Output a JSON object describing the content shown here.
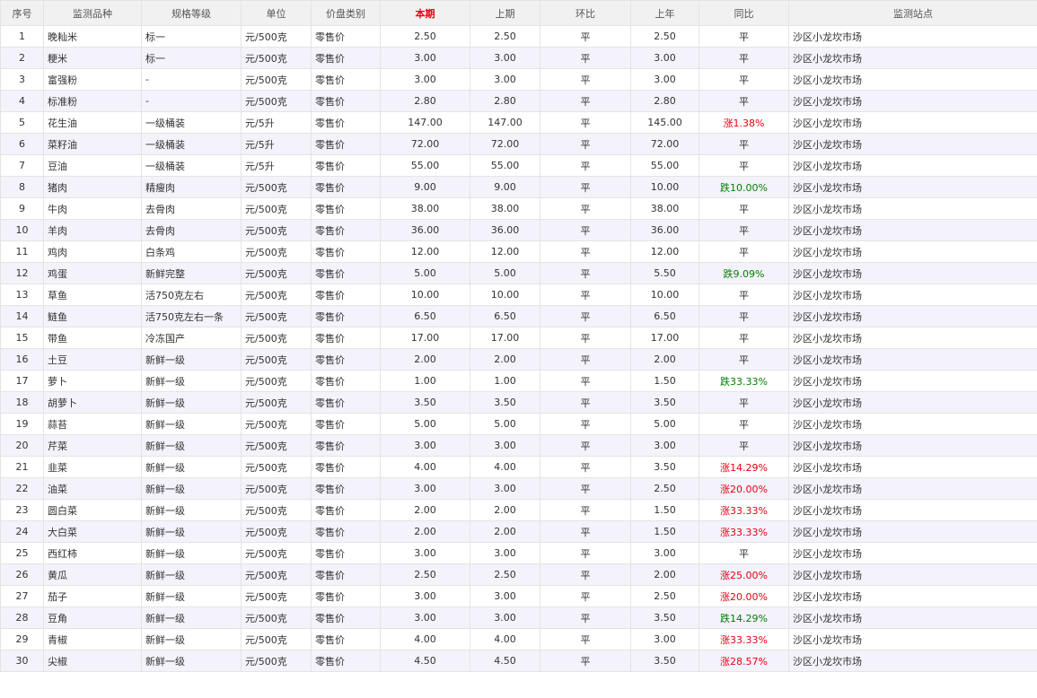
{
  "columns": [
    "序号",
    "监测品种",
    "规格等级",
    "单位",
    "价盘类别",
    "本期",
    "上期",
    "环比",
    "上年",
    "同比",
    "监测站点"
  ],
  "rows": [
    {
      "no": "1",
      "name": "晚籼米",
      "spec": "标一",
      "unit": "元/500克",
      "category": "零售价",
      "current": "2.50",
      "previous": "2.50",
      "mom": "平",
      "last_year": "2.50",
      "yoy": "平",
      "yoy_trend": "flat",
      "station": "沙区小龙坎市场"
    },
    {
      "no": "2",
      "name": "粳米",
      "spec": "标一",
      "unit": "元/500克",
      "category": "零售价",
      "current": "3.00",
      "previous": "3.00",
      "mom": "平",
      "last_year": "3.00",
      "yoy": "平",
      "yoy_trend": "flat",
      "station": "沙区小龙坎市场"
    },
    {
      "no": "3",
      "name": "富强粉",
      "spec": "-",
      "unit": "元/500克",
      "category": "零售价",
      "current": "3.00",
      "previous": "3.00",
      "mom": "平",
      "last_year": "3.00",
      "yoy": "平",
      "yoy_trend": "flat",
      "station": "沙区小龙坎市场"
    },
    {
      "no": "4",
      "name": "标准粉",
      "spec": "-",
      "unit": "元/500克",
      "category": "零售价",
      "current": "2.80",
      "previous": "2.80",
      "mom": "平",
      "last_year": "2.80",
      "yoy": "平",
      "yoy_trend": "flat",
      "station": "沙区小龙坎市场"
    },
    {
      "no": "5",
      "name": "花生油",
      "spec": "一级桶装",
      "unit": "元/5升",
      "category": "零售价",
      "current": "147.00",
      "previous": "147.00",
      "mom": "平",
      "last_year": "145.00",
      "yoy": "涨1.38%",
      "yoy_trend": "up",
      "station": "沙区小龙坎市场"
    },
    {
      "no": "6",
      "name": "菜籽油",
      "spec": "一级桶装",
      "unit": "元/5升",
      "category": "零售价",
      "current": "72.00",
      "previous": "72.00",
      "mom": "平",
      "last_year": "72.00",
      "yoy": "平",
      "yoy_trend": "flat",
      "station": "沙区小龙坎市场"
    },
    {
      "no": "7",
      "name": "豆油",
      "spec": "一级桶装",
      "unit": "元/5升",
      "category": "零售价",
      "current": "55.00",
      "previous": "55.00",
      "mom": "平",
      "last_year": "55.00",
      "yoy": "平",
      "yoy_trend": "flat",
      "station": "沙区小龙坎市场"
    },
    {
      "no": "8",
      "name": "猪肉",
      "spec": "精瘦肉",
      "unit": "元/500克",
      "category": "零售价",
      "current": "9.00",
      "previous": "9.00",
      "mom": "平",
      "last_year": "10.00",
      "yoy": "跌10.00%",
      "yoy_trend": "down",
      "station": "沙区小龙坎市场"
    },
    {
      "no": "9",
      "name": "牛肉",
      "spec": "去骨肉",
      "unit": "元/500克",
      "category": "零售价",
      "current": "38.00",
      "previous": "38.00",
      "mom": "平",
      "last_year": "38.00",
      "yoy": "平",
      "yoy_trend": "flat",
      "station": "沙区小龙坎市场"
    },
    {
      "no": "10",
      "name": "羊肉",
      "spec": "去骨肉",
      "unit": "元/500克",
      "category": "零售价",
      "current": "36.00",
      "previous": "36.00",
      "mom": "平",
      "last_year": "36.00",
      "yoy": "平",
      "yoy_trend": "flat",
      "station": "沙区小龙坎市场"
    },
    {
      "no": "11",
      "name": "鸡肉",
      "spec": "白条鸡",
      "unit": "元/500克",
      "category": "零售价",
      "current": "12.00",
      "previous": "12.00",
      "mom": "平",
      "last_year": "12.00",
      "yoy": "平",
      "yoy_trend": "flat",
      "station": "沙区小龙坎市场"
    },
    {
      "no": "12",
      "name": "鸡蛋",
      "spec": "新鲜完整",
      "unit": "元/500克",
      "category": "零售价",
      "current": "5.00",
      "previous": "5.00",
      "mom": "平",
      "last_year": "5.50",
      "yoy": "跌9.09%",
      "yoy_trend": "down",
      "station": "沙区小龙坎市场"
    },
    {
      "no": "13",
      "name": "草鱼",
      "spec": "活750克左右",
      "unit": "元/500克",
      "category": "零售价",
      "current": "10.00",
      "previous": "10.00",
      "mom": "平",
      "last_year": "10.00",
      "yoy": "平",
      "yoy_trend": "flat",
      "station": "沙区小龙坎市场"
    },
    {
      "no": "14",
      "name": "鲢鱼",
      "spec": "活750克左右一条",
      "unit": "元/500克",
      "category": "零售价",
      "current": "6.50",
      "previous": "6.50",
      "mom": "平",
      "last_year": "6.50",
      "yoy": "平",
      "yoy_trend": "flat",
      "station": "沙区小龙坎市场"
    },
    {
      "no": "15",
      "name": "带鱼",
      "spec": "冷冻国产",
      "unit": "元/500克",
      "category": "零售价",
      "current": "17.00",
      "previous": "17.00",
      "mom": "平",
      "last_year": "17.00",
      "yoy": "平",
      "yoy_trend": "flat",
      "station": "沙区小龙坎市场"
    },
    {
      "no": "16",
      "name": "土豆",
      "spec": "新鲜一级",
      "unit": "元/500克",
      "category": "零售价",
      "current": "2.00",
      "previous": "2.00",
      "mom": "平",
      "last_year": "2.00",
      "yoy": "平",
      "yoy_trend": "flat",
      "station": "沙区小龙坎市场"
    },
    {
      "no": "17",
      "name": "萝卜",
      "spec": "新鲜一级",
      "unit": "元/500克",
      "category": "零售价",
      "current": "1.00",
      "previous": "1.00",
      "mom": "平",
      "last_year": "1.50",
      "yoy": "跌33.33%",
      "yoy_trend": "down",
      "station": "沙区小龙坎市场"
    },
    {
      "no": "18",
      "name": "胡萝卜",
      "spec": "新鲜一级",
      "unit": "元/500克",
      "category": "零售价",
      "current": "3.50",
      "previous": "3.50",
      "mom": "平",
      "last_year": "3.50",
      "yoy": "平",
      "yoy_trend": "flat",
      "station": "沙区小龙坎市场"
    },
    {
      "no": "19",
      "name": "蒜苔",
      "spec": "新鲜一级",
      "unit": "元/500克",
      "category": "零售价",
      "current": "5.00",
      "previous": "5.00",
      "mom": "平",
      "last_year": "5.00",
      "yoy": "平",
      "yoy_trend": "flat",
      "station": "沙区小龙坎市场"
    },
    {
      "no": "20",
      "name": "芹菜",
      "spec": "新鲜一级",
      "unit": "元/500克",
      "category": "零售价",
      "current": "3.00",
      "previous": "3.00",
      "mom": "平",
      "last_year": "3.00",
      "yoy": "平",
      "yoy_trend": "flat",
      "station": "沙区小龙坎市场"
    },
    {
      "no": "21",
      "name": "韭菜",
      "spec": "新鲜一级",
      "unit": "元/500克",
      "category": "零售价",
      "current": "4.00",
      "previous": "4.00",
      "mom": "平",
      "last_year": "3.50",
      "yoy": "涨14.29%",
      "yoy_trend": "up",
      "station": "沙区小龙坎市场"
    },
    {
      "no": "22",
      "name": "油菜",
      "spec": "新鲜一级",
      "unit": "元/500克",
      "category": "零售价",
      "current": "3.00",
      "previous": "3.00",
      "mom": "平",
      "last_year": "2.50",
      "yoy": "涨20.00%",
      "yoy_trend": "up",
      "station": "沙区小龙坎市场"
    },
    {
      "no": "23",
      "name": "圆白菜",
      "spec": "新鲜一级",
      "unit": "元/500克",
      "category": "零售价",
      "current": "2.00",
      "previous": "2.00",
      "mom": "平",
      "last_year": "1.50",
      "yoy": "涨33.33%",
      "yoy_trend": "up",
      "station": "沙区小龙坎市场"
    },
    {
      "no": "24",
      "name": "大白菜",
      "spec": "新鲜一级",
      "unit": "元/500克",
      "category": "零售价",
      "current": "2.00",
      "previous": "2.00",
      "mom": "平",
      "last_year": "1.50",
      "yoy": "涨33.33%",
      "yoy_trend": "up",
      "station": "沙区小龙坎市场"
    },
    {
      "no": "25",
      "name": "西红柿",
      "spec": "新鲜一级",
      "unit": "元/500克",
      "category": "零售价",
      "current": "3.00",
      "previous": "3.00",
      "mom": "平",
      "last_year": "3.00",
      "yoy": "平",
      "yoy_trend": "flat",
      "station": "沙区小龙坎市场"
    },
    {
      "no": "26",
      "name": "黄瓜",
      "spec": "新鲜一级",
      "unit": "元/500克",
      "category": "零售价",
      "current": "2.50",
      "previous": "2.50",
      "mom": "平",
      "last_year": "2.00",
      "yoy": "涨25.00%",
      "yoy_trend": "up",
      "station": "沙区小龙坎市场"
    },
    {
      "no": "27",
      "name": "茄子",
      "spec": "新鲜一级",
      "unit": "元/500克",
      "category": "零售价",
      "current": "3.00",
      "previous": "3.00",
      "mom": "平",
      "last_year": "2.50",
      "yoy": "涨20.00%",
      "yoy_trend": "up",
      "station": "沙区小龙坎市场"
    },
    {
      "no": "28",
      "name": "豆角",
      "spec": "新鲜一级",
      "unit": "元/500克",
      "category": "零售价",
      "current": "3.00",
      "previous": "3.00",
      "mom": "平",
      "last_year": "3.50",
      "yoy": "跌14.29%",
      "yoy_trend": "down",
      "station": "沙区小龙坎市场"
    },
    {
      "no": "29",
      "name": "青椒",
      "spec": "新鲜一级",
      "unit": "元/500克",
      "category": "零售价",
      "current": "4.00",
      "previous": "4.00",
      "mom": "平",
      "last_year": "3.00",
      "yoy": "涨33.33%",
      "yoy_trend": "up",
      "station": "沙区小龙坎市场"
    },
    {
      "no": "30",
      "name": "尖椒",
      "spec": "新鲜一级",
      "unit": "元/500克",
      "category": "零售价",
      "current": "4.50",
      "previous": "4.50",
      "mom": "平",
      "last_year": "3.50",
      "yoy": "涨28.57%",
      "yoy_trend": "up",
      "station": "沙区小龙坎市场"
    }
  ],
  "colors": {
    "header_bg": "#f1f1f1",
    "current_header": "#e60012",
    "row_alt_bg": "#f4f2fb",
    "up": "#e60012",
    "down": "#008000",
    "border": "#e4e4e4"
  }
}
